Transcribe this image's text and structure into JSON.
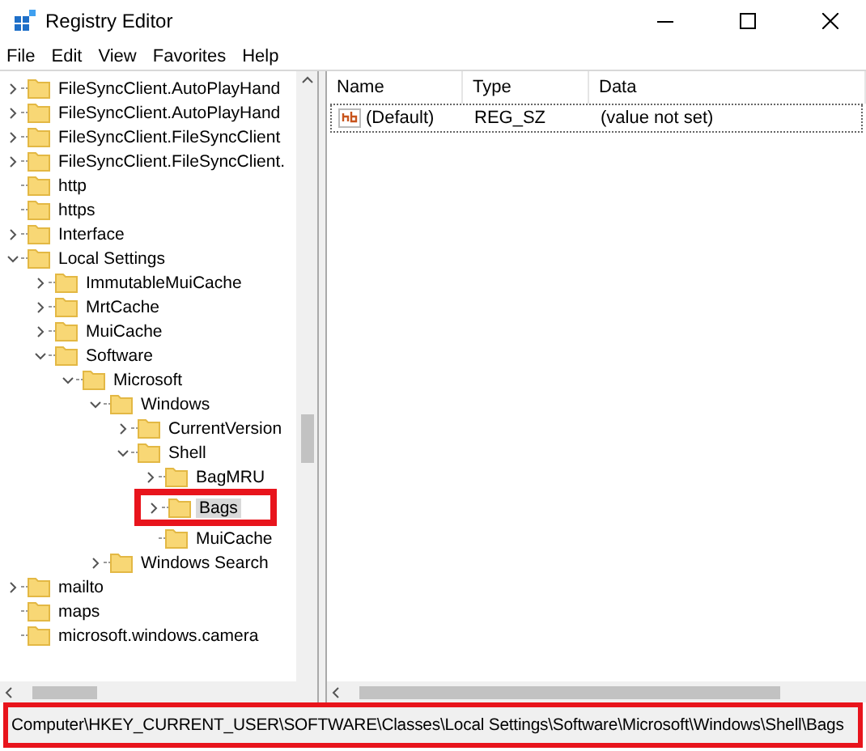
{
  "window": {
    "title": "Registry Editor"
  },
  "menu": [
    "File",
    "Edit",
    "View",
    "Favorites",
    "Help"
  ],
  "tree": [
    {
      "label": "FileSyncClient.AutoPlayHand",
      "expandable": true,
      "expanded": false,
      "selected": false
    },
    {
      "label": "FileSyncClient.AutoPlayHand",
      "expandable": true,
      "expanded": false,
      "selected": false
    },
    {
      "label": "FileSyncClient.FileSyncClient",
      "expandable": true,
      "expanded": false,
      "selected": false
    },
    {
      "label": "FileSyncClient.FileSyncClient.",
      "expandable": true,
      "expanded": false,
      "selected": false
    },
    {
      "label": "http",
      "expandable": false,
      "selected": false
    },
    {
      "label": "https",
      "expandable": false,
      "selected": false
    },
    {
      "label": "Interface",
      "expandable": true,
      "expanded": false,
      "selected": false
    },
    {
      "label": "Local Settings",
      "expandable": true,
      "expanded": true,
      "selected": false,
      "children": [
        {
          "label": "ImmutableMuiCache",
          "expandable": true,
          "expanded": false,
          "selected": false
        },
        {
          "label": "MrtCache",
          "expandable": true,
          "expanded": false,
          "selected": false
        },
        {
          "label": "MuiCache",
          "expandable": true,
          "expanded": false,
          "selected": false
        },
        {
          "label": "Software",
          "expandable": true,
          "expanded": true,
          "selected": false,
          "children": [
            {
              "label": "Microsoft",
              "expandable": true,
              "expanded": true,
              "selected": false,
              "children": [
                {
                  "label": "Windows",
                  "expandable": true,
                  "expanded": true,
                  "selected": false,
                  "children": [
                    {
                      "label": "CurrentVersion",
                      "expandable": true,
                      "expanded": false,
                      "selected": false
                    },
                    {
                      "label": "Shell",
                      "expandable": true,
                      "expanded": true,
                      "selected": false,
                      "children": [
                        {
                          "label": "BagMRU",
                          "expandable": true,
                          "expanded": false,
                          "selected": false
                        },
                        {
                          "label": "Bags",
                          "expandable": true,
                          "expanded": false,
                          "selected": true
                        },
                        {
                          "label": "MuiCache",
                          "expandable": false,
                          "selected": false
                        }
                      ]
                    }
                  ]
                },
                {
                  "label": "Windows Search",
                  "expandable": true,
                  "expanded": false,
                  "selected": false
                }
              ]
            }
          ]
        }
      ]
    },
    {
      "label": "mailto",
      "expandable": true,
      "expanded": false,
      "selected": false
    },
    {
      "label": "maps",
      "expandable": false,
      "selected": false
    },
    {
      "label": "microsoft.windows.camera",
      "expandable": false,
      "selected": false
    }
  ],
  "table": {
    "columns": [
      "Name",
      "Type",
      "Data"
    ],
    "rows": [
      {
        "name": "(Default)",
        "type": "REG_SZ",
        "data": "(value not set)",
        "selected": true
      }
    ]
  },
  "status_bar": "Computer\\HKEY_CURRENT_USER\\SOFTWARE\\Classes\\Local Settings\\Software\\Microsoft\\Windows\\Shell\\Bags"
}
